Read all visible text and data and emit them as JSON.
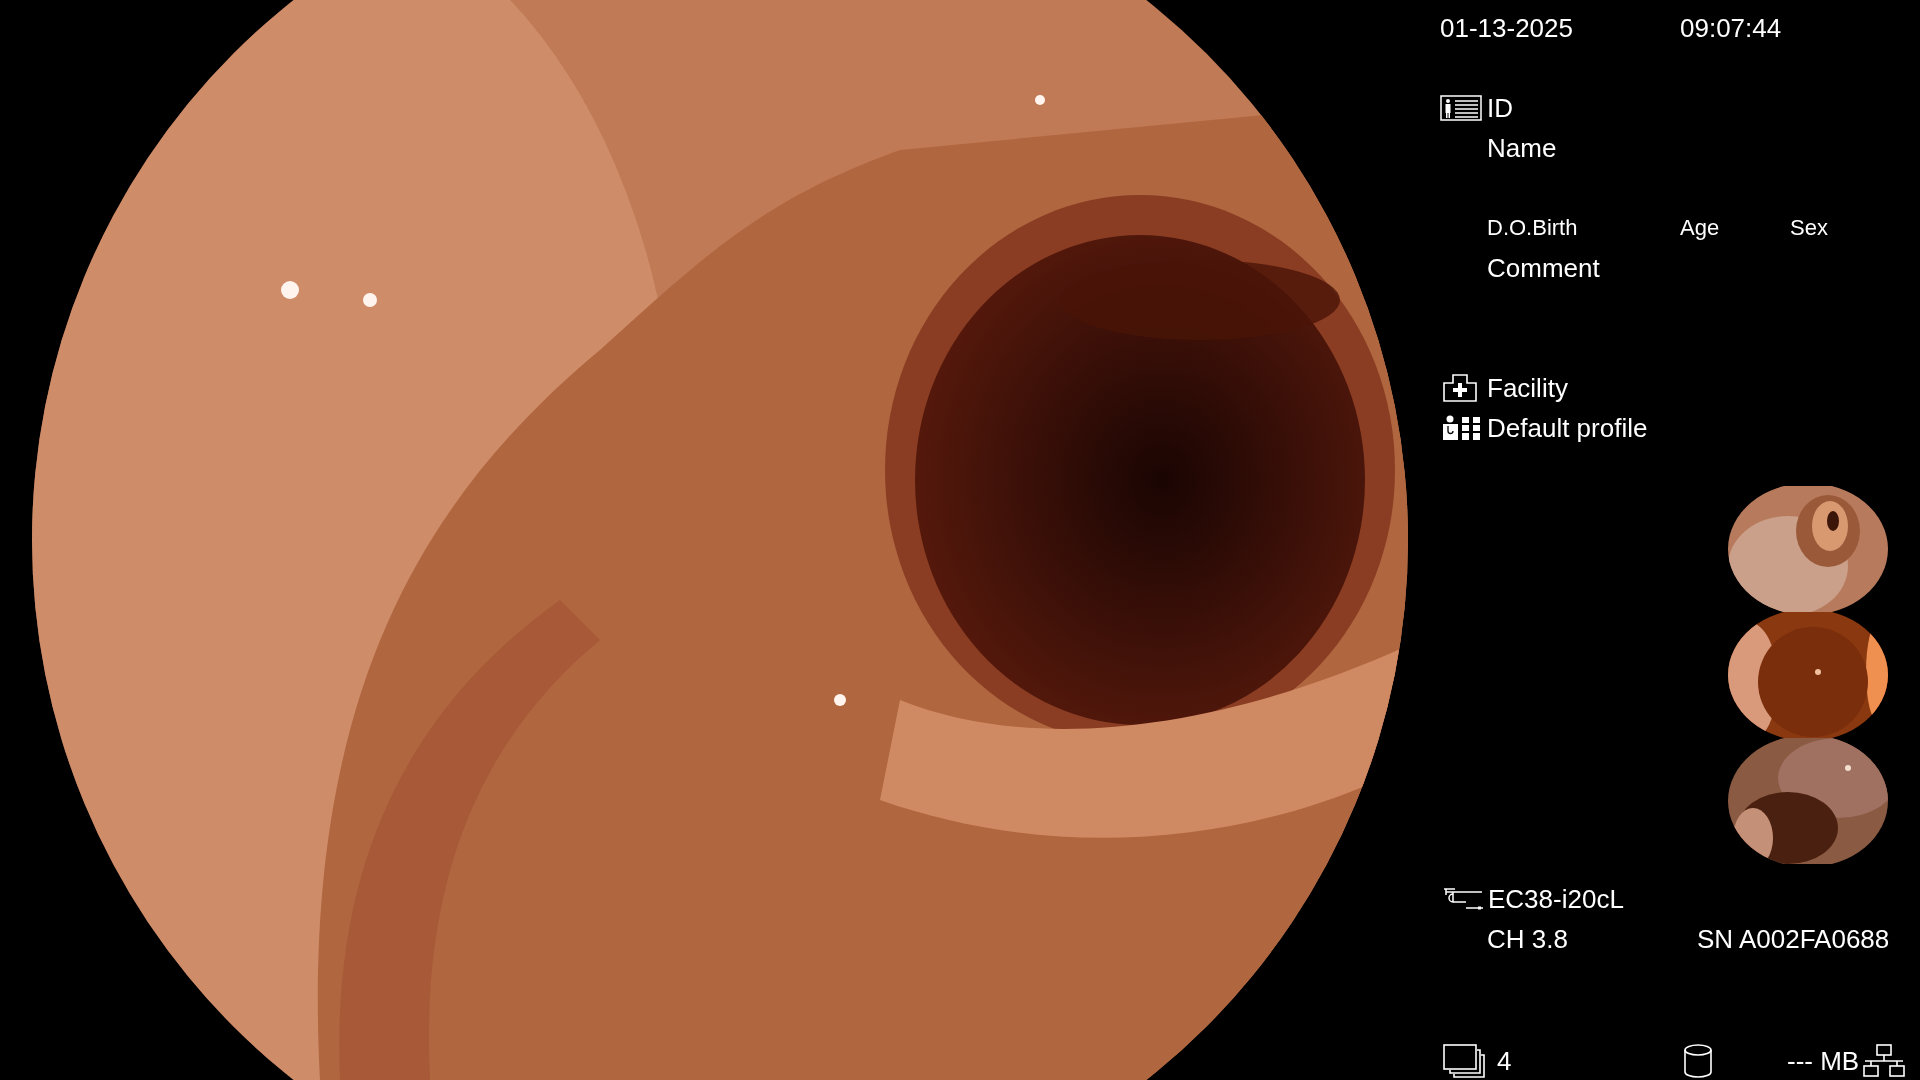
{
  "date": "01-13-2025",
  "time": "09:07:44",
  "patient": {
    "id_label": "ID",
    "name_label": "Name",
    "dob_label": "D.O.Birth",
    "age_label": "Age",
    "sex_label": "Sex",
    "comment_label": "Comment"
  },
  "facility": "Facility",
  "profile": "Default profile",
  "scope": {
    "model": "EC38-i20cL",
    "channel": "CH 3.8",
    "serial": "SN A002FA0688"
  },
  "status_bar": {
    "image_count": "4",
    "storage": "--- MB"
  }
}
